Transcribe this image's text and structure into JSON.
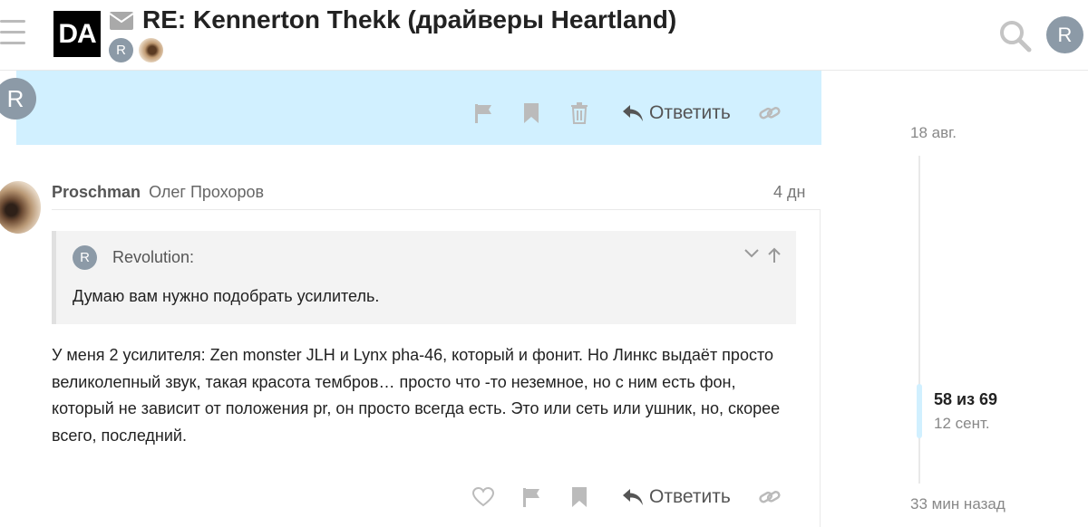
{
  "header": {
    "logo_text": "DA",
    "title": "RE: Kennerton Thekk (драйверы Heartland)",
    "participants": [
      {
        "initial": "R",
        "color": "#8c9aa7"
      },
      {
        "initial": "",
        "color": "#b79673"
      }
    ],
    "user_initial": "R"
  },
  "posts": [
    {
      "avatar_initial": "R",
      "actions": {
        "reply_label": "Ответить"
      }
    },
    {
      "username": "Proschman",
      "full_name": "Олег Прохоров",
      "date": "4 дн",
      "quote": {
        "avatar_initial": "R",
        "author": "Revolution:",
        "text": "Думаю вам нужно подобрать усилитель."
      },
      "body": "У меня 2 усилителя: Zen monster JLH и Lynx pha-46, который и фонит. Но Линкс выдаёт просто великолепный звук, такая красота тембров… просто что -то неземное, но с ним есть фон, который не зависит от положения pr, он просто всегда есть. Это или сеть или ушник, но, скорее всего, последний.",
      "actions": {
        "reply_label": "Ответить"
      }
    }
  ],
  "timeline": {
    "start_date": "18 авг.",
    "position": "58 из 69",
    "position_date": "12 сент.",
    "end_label": "33 мин назад",
    "current_post": 58,
    "total_posts": 69
  },
  "colors": {
    "highlight": "#d1f0ff",
    "icon_gray": "#bbbbbb",
    "avatar_gray": "#8c9aa7"
  }
}
